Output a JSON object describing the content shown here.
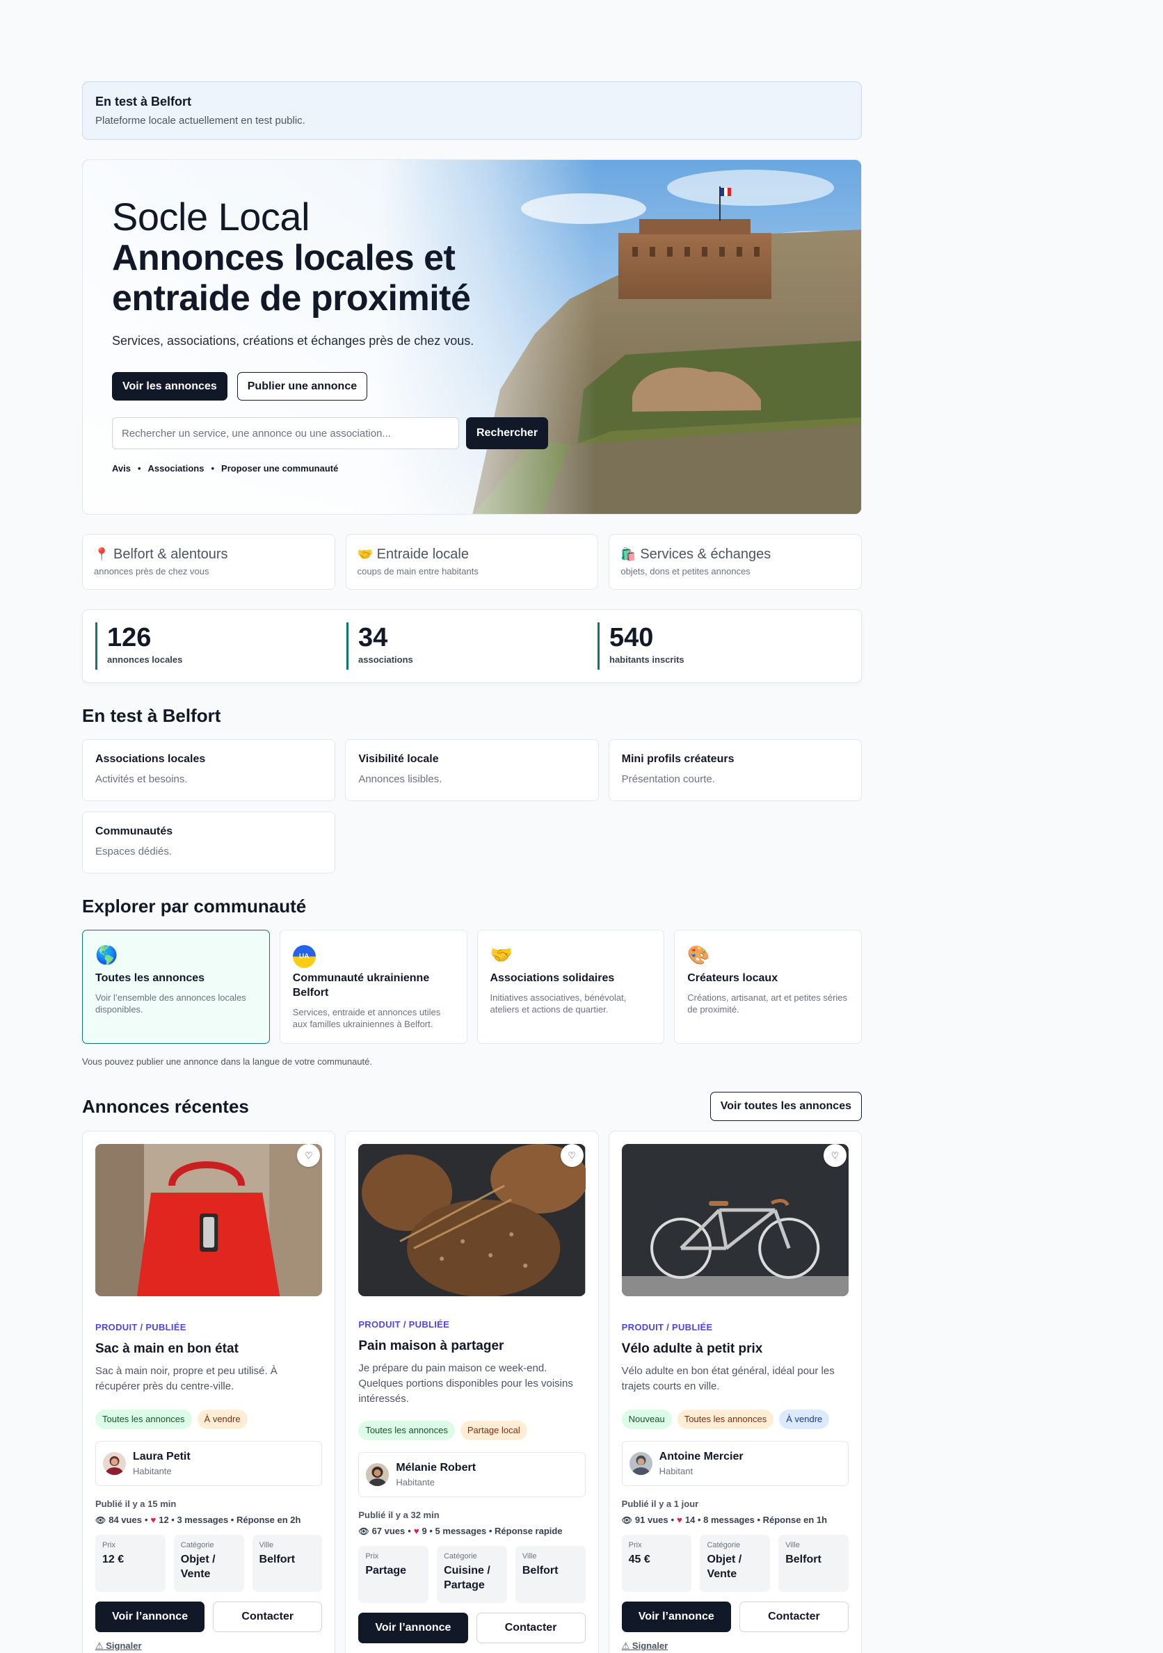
{
  "banner": {
    "title": "En test à Belfort",
    "subtitle": "Plateforme locale actuellement en test public."
  },
  "hero": {
    "brand": "Socle Local",
    "headline": "Annonces locales et entraide de proximité",
    "subtitle": "Services, associations, créations et échanges près de chez vous.",
    "primary_button": "Voir les annonces",
    "secondary_button": "Publier une annonce",
    "search_placeholder": "Rechercher un service, une annonce ou une association...",
    "search_button": "Rechercher",
    "links": [
      "Avis",
      "Associations",
      "Proposer une communauté"
    ]
  },
  "features": [
    {
      "icon": "pin-icon",
      "glyph": "📍",
      "title": "Belfort & alentours",
      "subtitle": "annonces près de chez vous"
    },
    {
      "icon": "handshake-icon",
      "glyph": "🤝",
      "title": "Entraide locale",
      "subtitle": "coups de main entre habitants"
    },
    {
      "icon": "shopping-bags-icon",
      "glyph": "🛍️",
      "title": "Services & échanges",
      "subtitle": "objets, dons et petites annonces"
    }
  ],
  "stats": [
    {
      "value": "126",
      "label": "annonces locales"
    },
    {
      "value": "34",
      "label": "associations"
    },
    {
      "value": "540",
      "label": "habitants inscrits"
    }
  ],
  "test_section": {
    "title": "En test à Belfort",
    "cards": [
      {
        "title": "Associations locales",
        "subtitle": "Activités et besoins."
      },
      {
        "title": "Visibilité locale",
        "subtitle": "Annonces lisibles."
      },
      {
        "title": "Mini profils créateurs",
        "subtitle": "Présentation courte."
      },
      {
        "title": "Communautés",
        "subtitle": "Espaces dédiés."
      }
    ]
  },
  "communities": {
    "title": "Explorer par communauté",
    "cards": [
      {
        "icon": "globe-icon",
        "glyph": "🌎",
        "title": "Toutes les annonces",
        "subtitle": "Voir l’ensemble des annonces locales disponibles."
      },
      {
        "icon": "ukraine-flag-icon",
        "glyph": "UA",
        "title": "Communauté ukrainienne Belfort",
        "subtitle": "Services, entraide et annonces utiles aux familles ukrainiennes à Belfort."
      },
      {
        "icon": "handshake-icon",
        "glyph": "🤝",
        "title": "Associations solidaires",
        "subtitle": "Initiatives associatives, bénévolat, ateliers et actions de quartier."
      },
      {
        "icon": "palette-icon",
        "glyph": "🎨",
        "title": "Créateurs locaux",
        "subtitle": "Créations, artisanat, art et petites séries de proximité."
      }
    ],
    "note": "Vous pouvez publier une annonce dans la langue de votre communauté."
  },
  "listings": {
    "title": "Annonces récentes",
    "see_all": "Voir toutes les annonces",
    "labels": {
      "price": "Prix",
      "category": "Catégorie",
      "city": "Ville",
      "view": "Voir l’annonce",
      "contact": "Contacter",
      "report": "⚠ Signaler"
    },
    "items": [
      {
        "tag": "PRODUIT / PUBLIÉE",
        "title": "Sac à main en bon état",
        "description": "Sac à main noir, propre et peu utilisé. À récupérer près du centre-ville.",
        "chips": [
          "Toutes les annonces",
          "À vendre"
        ],
        "user": "Laura Petit",
        "role": "Habitante",
        "published": "Publié il y a 15 min",
        "views": "84 vues",
        "stats": "12 • 3 messages • Réponse en 2h",
        "price": "12 €",
        "category": "Objet / Vente",
        "city": "Belfort"
      },
      {
        "tag": "PRODUIT / PUBLIÉE",
        "title": "Pain maison à partager",
        "description": "Je prépare du pain maison ce week-end. Quelques portions disponibles pour les voisins intéressés.",
        "chips": [
          "Toutes les annonces",
          "Partage local"
        ],
        "user": "Mélanie Robert",
        "role": "Habitante",
        "published": "Publié il y a 32 min",
        "views": "67 vues",
        "stats": "9 • 5 messages • Réponse rapide",
        "price": "Partage",
        "category": "Cuisine / Partage",
        "city": "Belfort"
      },
      {
        "tag": "PRODUIT / PUBLIÉE",
        "title": "Vélo adulte à petit prix",
        "description": "Vélo adulte en bon état général, idéal pour les trajets courts en ville.",
        "chips": [
          "Nouveau",
          "Toutes les annonces",
          "À vendre"
        ],
        "user": "Antoine Mercier",
        "role": "Habitant",
        "published": "Publié il y a 1 jour",
        "views": "91 vues",
        "stats": "14 • 8 messages • Réponse en 1h",
        "price": "45 €",
        "category": "Objet / Vente",
        "city": "Belfort"
      }
    ]
  },
  "colors": {
    "accent": "#0f766e",
    "dark": "#111827",
    "tag": "#4f46e5",
    "banner_bg": "#eef4fc"
  }
}
